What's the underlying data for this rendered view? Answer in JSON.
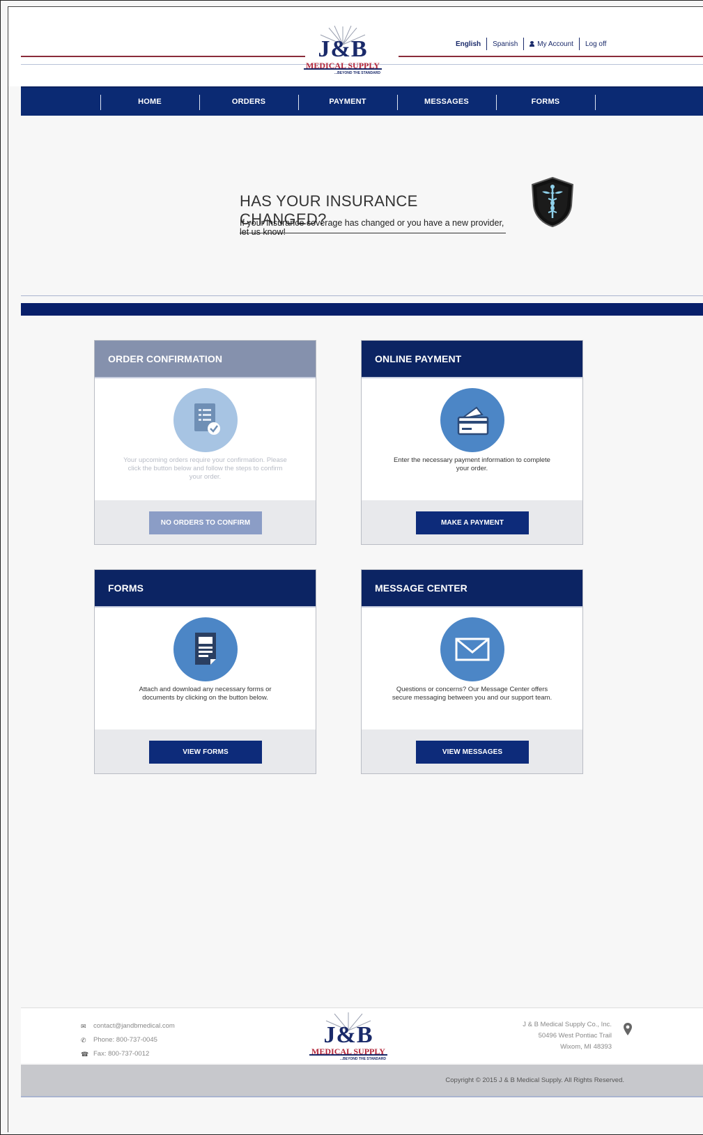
{
  "brand": {
    "logo_main": "J&B",
    "logo_sub": "MEDICAL SUPPLY",
    "logo_tagline": "...BEYOND THE STANDARD"
  },
  "toplinks": {
    "english": "English",
    "spanish": "Spanish",
    "account": "My Account",
    "logoff": "Log off"
  },
  "nav": {
    "items": [
      {
        "label": "HOME"
      },
      {
        "label": "ORDERS"
      },
      {
        "label": "PAYMENT"
      },
      {
        "label": "MESSAGES"
      },
      {
        "label": "FORMS"
      }
    ]
  },
  "banner": {
    "title": "HAS YOUR INSURANCE CHANGED?",
    "text": "If your insurance coverage has changed or you have a new provider, let us know!",
    "icon": "caduceus-shield-icon"
  },
  "cards": {
    "order": {
      "title": "ORDER CONFIRMATION",
      "desc": "Your upcoming orders require your confirmation. Please click the button below and follow the steps to confirm your order.",
      "button": "NO ORDERS TO CONFIRM",
      "icon": "document-check-icon"
    },
    "payment": {
      "title": "ONLINE PAYMENT",
      "desc": "Enter the necessary payment information to complete your order.",
      "button": "MAKE A PAYMENT",
      "icon": "credit-card-icon"
    },
    "forms": {
      "title": "FORMS",
      "desc": "Attach and download any necessary forms or documents by clicking on the button below.",
      "button": "VIEW FORMS",
      "icon": "form-document-icon"
    },
    "messages": {
      "title": "MESSAGE CENTER",
      "desc": "Questions or concerns? Our Message Center offers secure messaging between you and our support team.",
      "button": "VIEW MESSAGES",
      "icon": "envelope-icon"
    }
  },
  "footer": {
    "email": "contact@jandbmedical.com",
    "phone": "Phone: 800-737-0045",
    "fax": "Fax: 800-737-0012",
    "company": "J & B Medical Supply Co., Inc.",
    "street": "50496 West Pontiac Trail",
    "city": "Wixom, MI 48393",
    "copyright": "Copyright © 2015 J & B Medical Supply. All Rights Reserved."
  },
  "colors": {
    "navy": "#0b2a73",
    "accent_red": "#8a2b3a",
    "icon_blue": "#4c86c6"
  }
}
